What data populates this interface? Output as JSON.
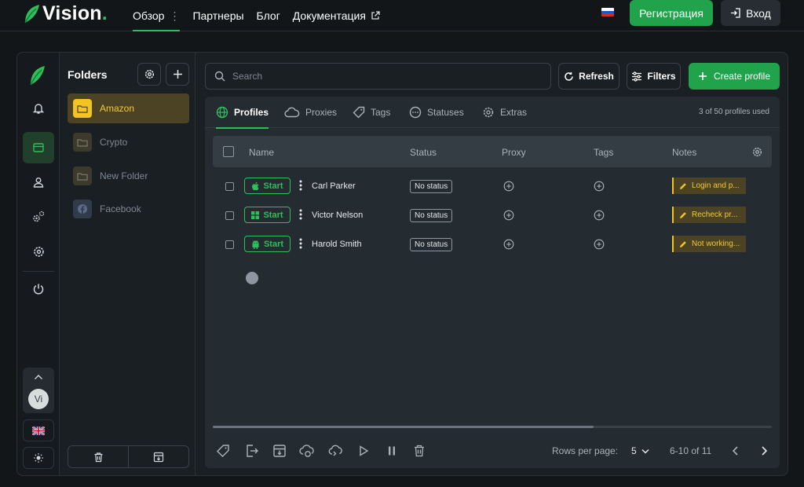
{
  "brand": {
    "name": "Vision",
    "dot": ".",
    "accent": "#2fbf5a",
    "folder_color": "#f2c520"
  },
  "nav": {
    "items": [
      {
        "label": "Обзор",
        "active": true
      },
      {
        "label": "Партнеры"
      },
      {
        "label": "Блог"
      },
      {
        "label": "Документация",
        "external": true
      }
    ],
    "language_flag": "russia-flag",
    "register_label": "Регистрация",
    "login_label": "Вход"
  },
  "rail": {
    "icons": [
      "bell-icon",
      "browser-window-icon",
      "user-icon",
      "gears-icon",
      "settings-icon",
      "power-icon"
    ],
    "avatar_initials": "Vi",
    "language_flag": "uk-flag",
    "theme_icon": "sun-icon"
  },
  "folders": {
    "title": "Folders",
    "items": [
      {
        "label": "Amazon",
        "active": true,
        "icon": "folder-icon"
      },
      {
        "label": "Crypto",
        "icon": "folder-icon"
      },
      {
        "label": "New Folder",
        "icon": "folder-icon"
      },
      {
        "label": "Facebook",
        "icon": "facebook-icon"
      }
    ]
  },
  "toolbar": {
    "search_placeholder": "Search",
    "refresh_label": "Refresh",
    "filters_label": "Filters",
    "create_label": "Create profile"
  },
  "tabs": [
    {
      "label": "Profiles",
      "active": true,
      "icon": "globe-icon"
    },
    {
      "label": "Proxies",
      "icon": "cloud-icon"
    },
    {
      "label": "Tags",
      "icon": "tag-icon"
    },
    {
      "label": "Statuses",
      "icon": "dots-circle-icon"
    },
    {
      "label": "Extras",
      "icon": "gear-icon"
    }
  ],
  "usage": "3 of 50 profiles used",
  "table": {
    "columns": [
      "Name",
      "Status",
      "Proxy",
      "Tags",
      "Notes"
    ],
    "rows": [
      {
        "os": "apple-icon",
        "start": "Start",
        "name": "Carl Parker",
        "status": "No status",
        "note": "Login and p..."
      },
      {
        "os": "windows-icon",
        "start": "Start",
        "name": "Victor Nelson",
        "status": "No status",
        "note": "Recheck pr..."
      },
      {
        "os": "android-icon",
        "start": "Start",
        "name": "Harold Smith",
        "status": "No status",
        "note": "Not working..."
      }
    ]
  },
  "footer": {
    "actions": [
      "tag-icon",
      "export-icon",
      "archive-icon",
      "cloud-sync-icon",
      "transfer-icon",
      "play-icon",
      "pause-icon",
      "trash-icon"
    ],
    "rows_per_page_label": "Rows per page:",
    "rows_per_page_value": "5",
    "range": "6-10 of 11"
  }
}
